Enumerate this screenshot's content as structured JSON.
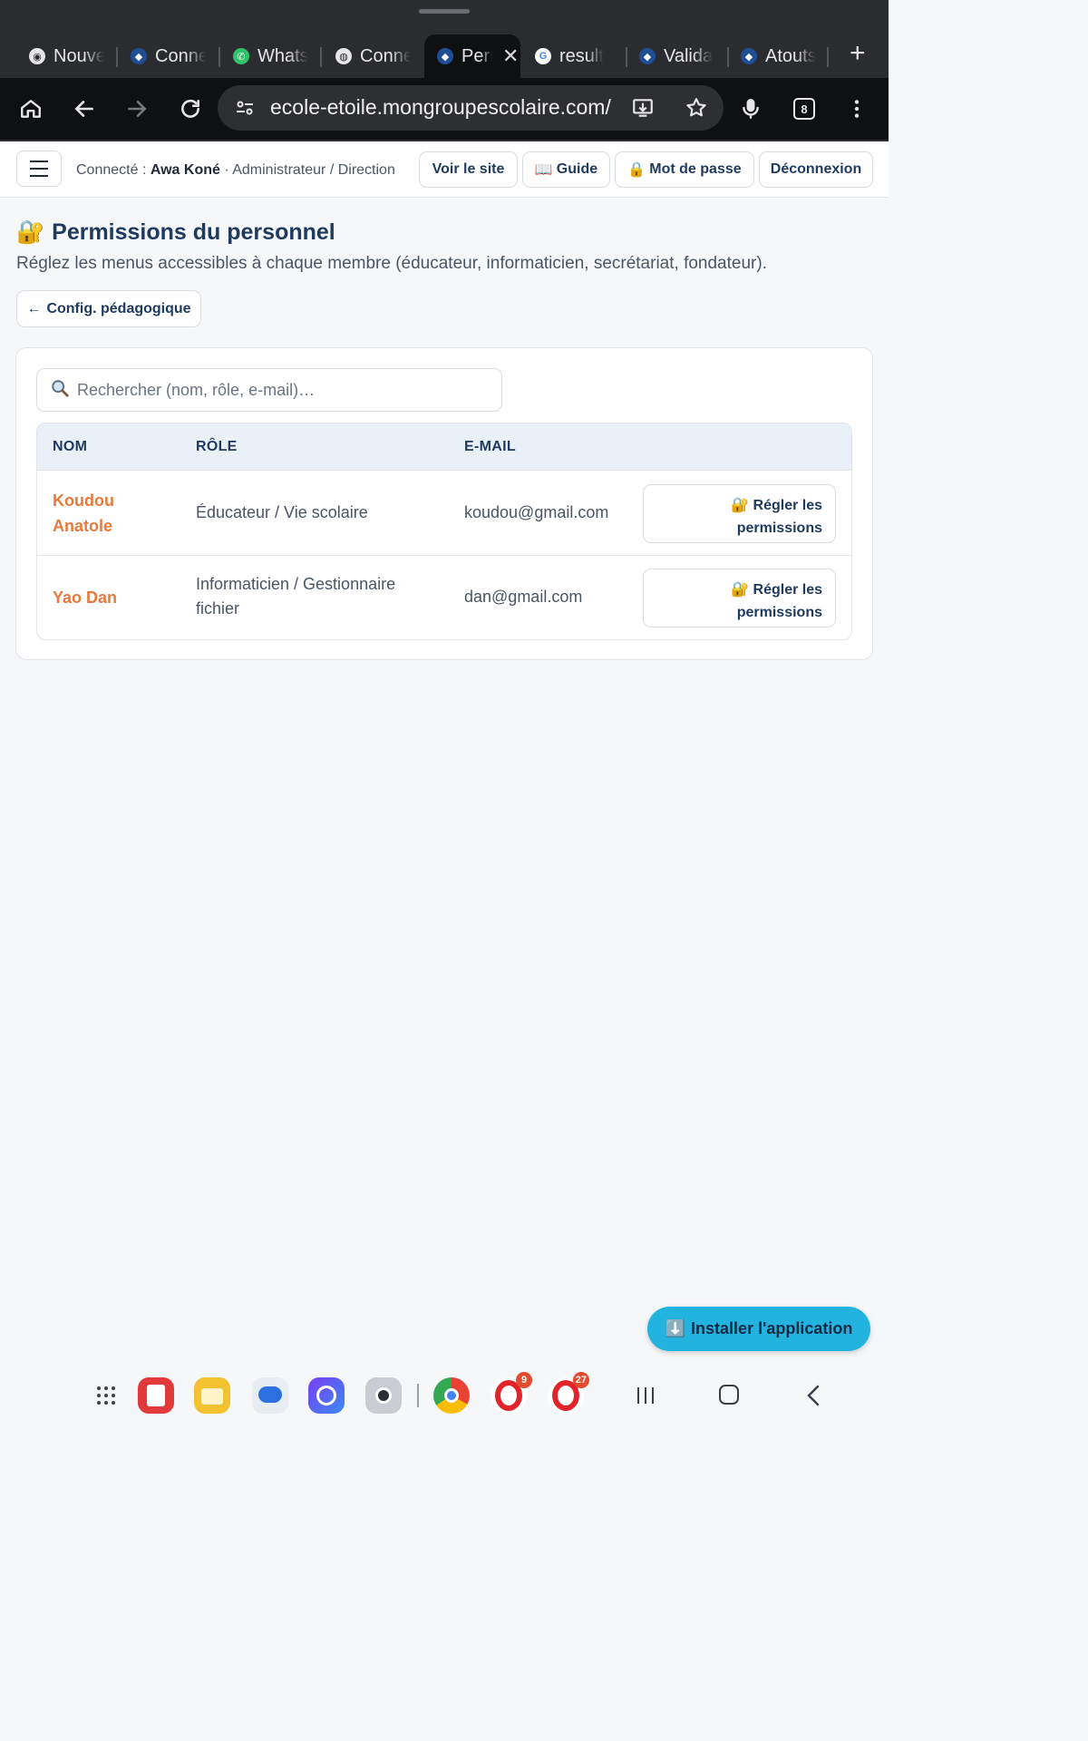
{
  "browser": {
    "tabs": [
      {
        "label": "Nouve",
        "icon": "chrome-icon"
      },
      {
        "label": "Conne",
        "icon": "school-icon"
      },
      {
        "label": "Whats",
        "icon": "whatsapp-icon"
      },
      {
        "label": "Conne",
        "icon": "globe-icon"
      },
      {
        "label": "Perr",
        "icon": "school-icon",
        "active": true
      },
      {
        "label": "result",
        "icon": "google-icon"
      },
      {
        "label": "Valida",
        "icon": "school-icon"
      },
      {
        "label": "Atouts",
        "icon": "school-icon"
      }
    ],
    "url": "ecole-etoile.mongroupescolaire.com/",
    "tab_count": "8"
  },
  "header": {
    "connected_prefix": "Connecté : ",
    "user_name": "Awa Koné",
    "role_suffix": " · Administrateur / Direction",
    "buttons": {
      "view_site": "Voir le site",
      "guide": "Guide",
      "password": "Mot de passe",
      "logout": "Déconnexion"
    }
  },
  "page": {
    "title_icon": "🔐",
    "title": "Permissions du personnel",
    "subtitle": "Réglez les menus accessibles à chaque membre (éducateur, informaticien, secrétariat, fondateur).",
    "back_button": "Config. pédagogique",
    "back_arrow": "←"
  },
  "search": {
    "placeholder": "Rechercher (nom, rôle, e-mail)…",
    "value": ""
  },
  "table": {
    "columns": [
      "NOM",
      "RÔLE",
      "E-MAIL"
    ],
    "rows": [
      {
        "name": "Koudou Anatole",
        "role": "Éducateur / Vie scolaire",
        "email": "koudou@gmail.com",
        "action": "Régler les permissions"
      },
      {
        "name": "Yao Dan",
        "role": "Informaticien / Gestionnaire fichier",
        "email": "dan@gmail.com",
        "action": "Régler les permissions"
      }
    ]
  },
  "install_button": "Installer l'application",
  "dock": {
    "badges": {
      "opera_mini": "9",
      "opera": "27"
    }
  },
  "colors": {
    "accent_orange": "#e8793a",
    "navy": "#1e3a5f",
    "install_blue": "#22b4df",
    "chrome_dark": "#2b2c30"
  }
}
